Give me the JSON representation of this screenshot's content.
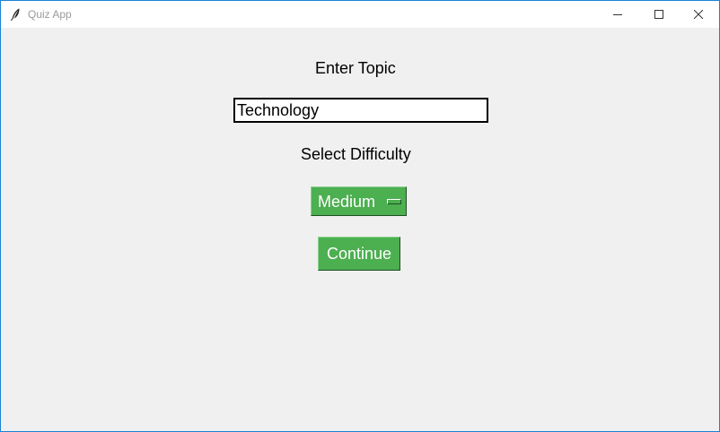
{
  "window": {
    "title": "Quiz App",
    "app_icon": "feather-icon",
    "controls": {
      "minimize": "minimize-icon",
      "maximize": "maximize-icon",
      "close": "close-icon"
    }
  },
  "form": {
    "topic_label": "Enter Topic",
    "topic_value": "Technology",
    "difficulty_label": "Select Difficulty",
    "difficulty_selected": "Medium",
    "continue_label": "Continue"
  },
  "colors": {
    "accent": "#4caf50",
    "background": "#f0f0f0",
    "window_border": "#1883d7",
    "button_text": "#ffffff"
  }
}
